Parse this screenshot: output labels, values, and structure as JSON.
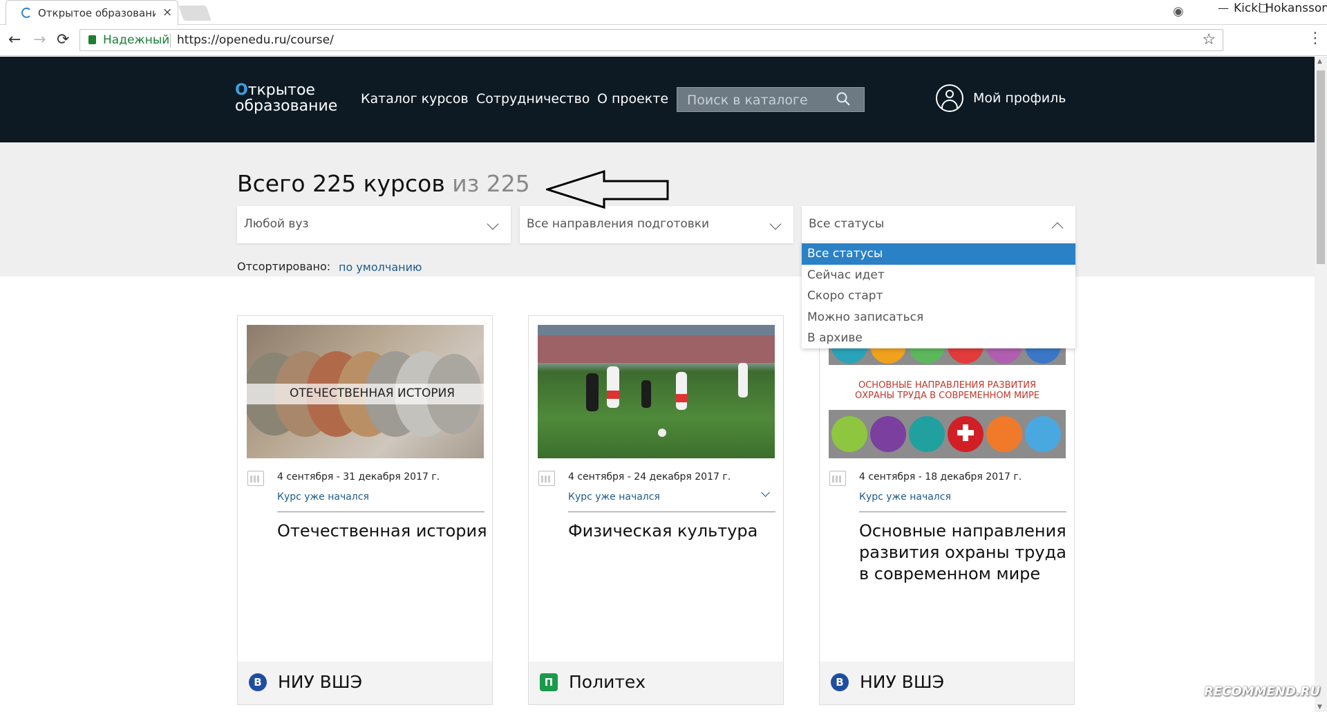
{
  "browser": {
    "tab_title": "Открытое образование",
    "tab_close": "×",
    "user_name": "Kicki Hokansson",
    "win_min": "—",
    "back": "←",
    "forward": "→",
    "reload": "⟳",
    "secure_label": "Надежный",
    "url": "https://openedu.ru/course/",
    "star": "☆",
    "menu": "⋮",
    "profile_icon": "◉"
  },
  "header": {
    "logo_line1_o": "О",
    "logo_line1_rest": "ткрытое",
    "logo_line2": "образование",
    "nav": [
      "Каталог курсов",
      "Сотрудничество",
      "О проекте"
    ],
    "search_placeholder": "Поиск в каталоге",
    "profile_label": "Мой профиль"
  },
  "filters": {
    "count_prefix": "Всего 225 курсов",
    "count_suffix": "из 225",
    "university_select": "Любой вуз",
    "direction_select": "Все направления подготовки",
    "status_select": "Все статусы",
    "sorted_label": "Отсортировано:",
    "sorted_value": "по умолчанию",
    "status_options": [
      "Все статусы",
      "Сейчас идет",
      "Скоро старт",
      "Можно записаться",
      "В архиве"
    ],
    "selected_status_index": 0
  },
  "courses": [
    {
      "image_caption": "ОТЕЧЕСТВЕННАЯ ИСТОРИЯ",
      "dates": "4 сентября - 31 декабря 2017 г.",
      "status": "Курс уже начался",
      "title": "Отечественная история",
      "university": "НИУ ВШЭ",
      "uni_icon_letter": "В",
      "uni_icon_color": "#1f4ea0"
    },
    {
      "image_caption": "",
      "dates": "4 сентября - 24 декабря 2017 г.",
      "status": "Курс уже начался",
      "title": "Физическая культура",
      "university": "Политех",
      "uni_icon_letter": "П",
      "uni_icon_color": "#1a9a4a"
    },
    {
      "image_caption": "ОСНОВНЫЕ НАПРАВЛЕНИЯ РАЗВИТИЯ ОХРАНЫ ТРУДА В СОВРЕМЕННОМ МИРЕ",
      "dates": "4 сентября - 18 декабря 2017 г.",
      "status": "Курс уже начался",
      "title": "Основные направления развития охраны труда в современном мире",
      "university": "НИУ ВШЭ",
      "uni_icon_letter": "В",
      "uni_icon_color": "#1f4ea0"
    }
  ],
  "watermark": "RECOMMEND.RU",
  "colors": {
    "header_bg": "#0d1a24",
    "accent_blue": "#2b81c6",
    "link_blue": "#1c5a8a"
  }
}
